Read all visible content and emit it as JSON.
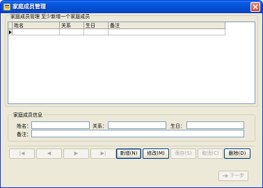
{
  "window": {
    "title": "家庭成员管理"
  },
  "members_group": {
    "legend": "家庭成员管理 至少新增一个家庭成员"
  },
  "grid": {
    "columns": [
      "姓名",
      "关系",
      "生日",
      "备注"
    ]
  },
  "info_group": {
    "legend": "家庭成员信息",
    "name_label": "姓名：",
    "relation_label": "关系：",
    "birthday_label": "生日：",
    "remark_label": "备注：",
    "name_value": "",
    "relation_value": "",
    "birthday_value": "",
    "remark_value": ""
  },
  "navigation": {
    "first": "|◀",
    "prev": "◀",
    "next": "▶",
    "last": "▶|"
  },
  "actions": {
    "add": "新增(N)",
    "edit": "修改(M)",
    "save": "保存(S)",
    "cancel": "取消(C)",
    "delete": "删除(D)"
  },
  "wizard": {
    "next": "下一步"
  },
  "colors": {
    "titlebar": "#0553d6",
    "window_bg": "#ece9d8",
    "border": "#7f9db9"
  },
  "icons": {
    "app": "app-icon",
    "close": "close-icon",
    "next": "arrow-right-icon"
  }
}
